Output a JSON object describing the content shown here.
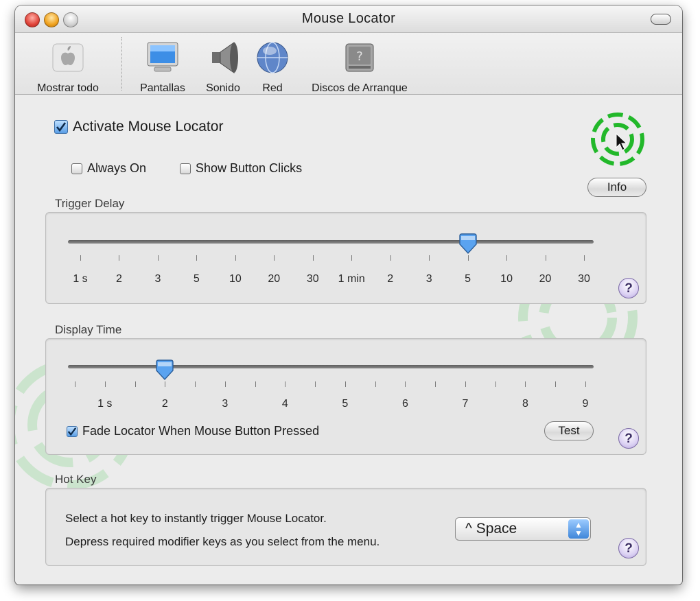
{
  "window": {
    "title": "Mouse Locator"
  },
  "toolbar": {
    "items": [
      {
        "label": "Mostrar todo",
        "icon": "apple-logo-icon"
      },
      {
        "label": "Pantallas",
        "icon": "display-icon"
      },
      {
        "label": "Sonido",
        "icon": "speaker-icon"
      },
      {
        "label": "Red",
        "icon": "globe-icon"
      },
      {
        "label": "Discos de Arranque",
        "icon": "startup-disk-icon"
      }
    ]
  },
  "main": {
    "activate_label": "Activate Mouse Locator",
    "activate_checked": true,
    "always_on_label": "Always On",
    "always_on_checked": false,
    "show_clicks_label": "Show Button Clicks",
    "show_clicks_checked": false,
    "info_button": "Info"
  },
  "trigger_delay": {
    "title": "Trigger Delay",
    "ticks": [
      "1 s",
      "2",
      "3",
      "5",
      "10",
      "20",
      "30",
      "1 min",
      "2",
      "3",
      "5",
      "10",
      "20",
      "30"
    ],
    "selected_tick_index": 10
  },
  "display_time": {
    "title": "Display Time",
    "ticks": [
      "1 s",
      "2",
      "3",
      "4",
      "5",
      "6",
      "7",
      "8",
      "9"
    ],
    "selected_value": "2",
    "fade_label": "Fade Locator When Mouse Button Pressed",
    "fade_checked": true,
    "test_button": "Test"
  },
  "hot_key": {
    "title": "Hot Key",
    "line1": "Select a hot key to instantly trigger Mouse Locator.",
    "line2": "Depress required modifier keys as you select from the menu.",
    "selected": "^ Space"
  },
  "help_label": "?",
  "colors": {
    "locator_green": "#22b82a",
    "help_purple": "#b7a6e0",
    "popup_blue": "#3f86d9"
  }
}
